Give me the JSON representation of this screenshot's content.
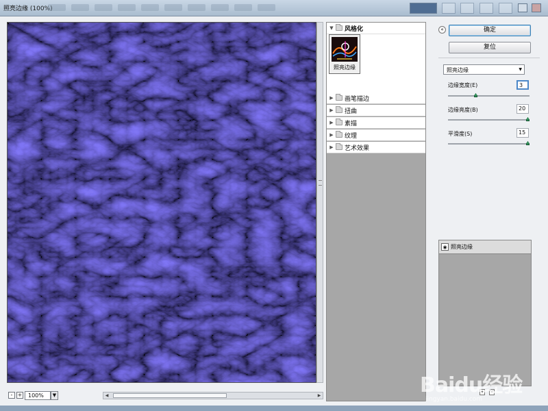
{
  "window": {
    "title": "照亮边缘 (100%)"
  },
  "preview": {
    "zoom": "100%"
  },
  "gallery": {
    "open_category": "风格化",
    "thumbnail": "照亮边缘",
    "categories": [
      "画笔描边",
      "扭曲",
      "素描",
      "纹理",
      "艺术效果"
    ]
  },
  "buttons": {
    "ok": "确定",
    "reset": "复位"
  },
  "filter": {
    "selected": "照亮边缘",
    "params": [
      {
        "label": "边缘宽度(E)",
        "value": "3",
        "fraction": 0.33
      },
      {
        "label": "边缘亮度(B)",
        "value": "20",
        "fraction": 1.0
      },
      {
        "label": "平滑度(S)",
        "value": "15",
        "fraction": 1.0
      }
    ]
  },
  "layers": {
    "items": [
      "照亮边缘"
    ]
  },
  "watermark": {
    "brand": "Baidu经验",
    "url": "jingyan.baidu.com"
  },
  "colors": {
    "preview_bg": "#0b0718",
    "glow": "#3a34c8",
    "gallery_bg": "#a7a7a7"
  }
}
